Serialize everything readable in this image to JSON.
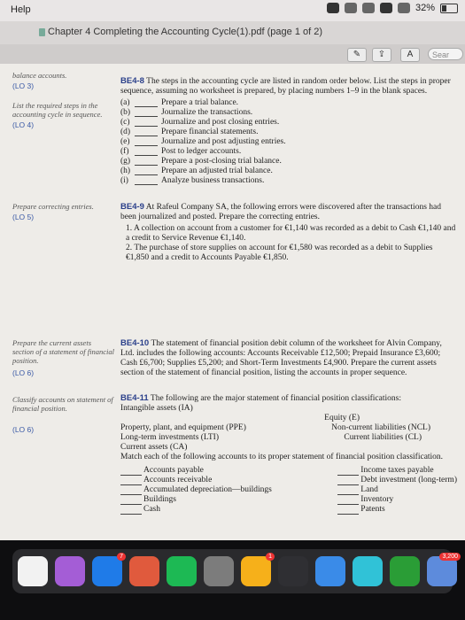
{
  "menubar": {
    "help_label": "Help",
    "battery": "32%"
  },
  "window": {
    "title": "Chapter 4 Completing the Accounting Cycle(1).pdf (page 1 of 2)"
  },
  "toolbar": {
    "search_placeholder": "Sear"
  },
  "margin": {
    "top_cut": "balance accounts.",
    "lo3": "(LO 3)",
    "list_steps": "List the required steps in the accounting cycle in sequence.",
    "lo4": "(LO 4)",
    "prepare_correcting": "Prepare correcting entries.",
    "lo5": "(LO 5)",
    "prepare_current": "Prepare the current assets section of a statement of financial position.",
    "lo6a": "(LO 6)",
    "classify": "Classify accounts on statement of financial position.",
    "lo6b": "(LO 6)"
  },
  "be48": {
    "number": "BE4-8",
    "text": "The steps in the accounting cycle are listed in random order below. List the steps in proper sequence, assuming no worksheet is prepared, by placing numbers 1–9 in the blank spaces.",
    "steps": [
      {
        "letter": "(a)",
        "text": "Prepare a trial balance."
      },
      {
        "letter": "(b)",
        "text": "Journalize the transactions."
      },
      {
        "letter": "(c)",
        "text": "Journalize and post closing entries."
      },
      {
        "letter": "(d)",
        "text": "Prepare financial statements."
      },
      {
        "letter": "(e)",
        "text": "Journalize and post adjusting entries."
      },
      {
        "letter": "(f)",
        "text": "Post to ledger accounts."
      },
      {
        "letter": "(g)",
        "text": "Prepare a post-closing trial balance."
      },
      {
        "letter": "(h)",
        "text": "Prepare an adjusted trial balance."
      },
      {
        "letter": "(i)",
        "text": "Analyze business transactions."
      }
    ]
  },
  "be49": {
    "number": "BE4-9",
    "text": "At Rafeul Company SA, the following errors were discovered after the transactions had been journalized and posted. Prepare the correcting entries.",
    "item1": "1. A collection on account from a customer for €1,140 was recorded as a debit to Cash €1,140 and a credit to Service Revenue €1,140.",
    "item2": "2. The purchase of store supplies on account for €1,580 was recorded as a debit to Supplies €1,850 and a credit to Accounts Payable €1,850."
  },
  "be410": {
    "number": "BE4-10",
    "text": "The statement of financial position debit column of the worksheet for Alvin Company, Ltd. includes the following accounts: Accounts Receivable £12,500; Prepaid Insurance £3,600; Cash £6,700; Supplies £5,200; and Short-Term Investments £4,900. Prepare the current assets section of the statement of financial position, listing the accounts in proper sequence."
  },
  "be411": {
    "number": "BE4-11",
    "text": "The following are the major statement of financial position classifications:",
    "classifications": [
      [
        "Intangible assets (IA)",
        ""
      ],
      [
        "",
        "Equity (E)"
      ],
      [
        "Property, plant, and equipment (PPE)",
        "Non-current liabilities (NCL)"
      ],
      [
        "Long-term investments (LTI)",
        "Current liabilities (CL)"
      ],
      [
        "Current assets (CA)",
        ""
      ]
    ],
    "instruction": "Match each of the following accounts to its proper statement of financial position classification.",
    "accounts_left": [
      "Accounts payable",
      "Accounts receivable",
      "Accumulated depreciation—buildings",
      "Buildings",
      "Cash"
    ],
    "accounts_right": [
      "Income taxes payable",
      "Debt investment (long-term)",
      "Land",
      "Inventory",
      "Patents"
    ]
  },
  "dock": {
    "badge_app": "7",
    "badge_photos": "1",
    "badge_mail": "3,200"
  }
}
